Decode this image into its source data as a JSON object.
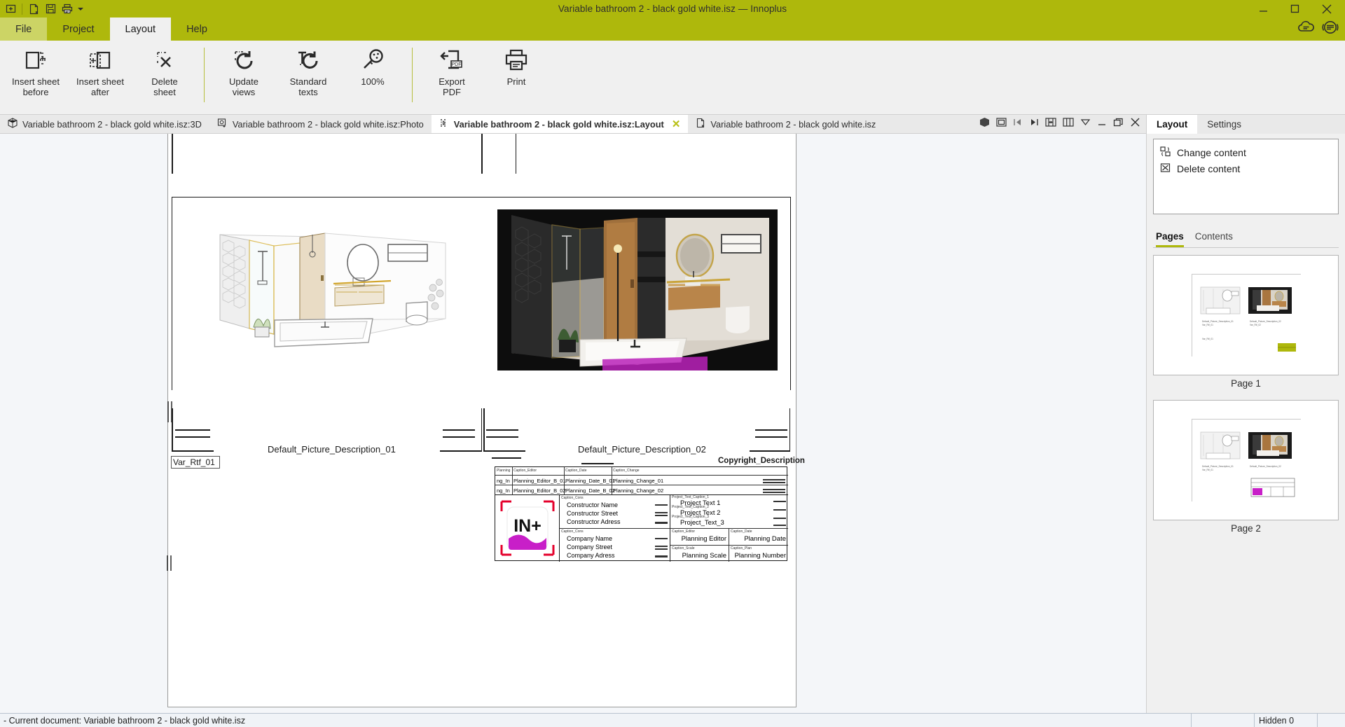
{
  "window": {
    "title": "Variable bathroom 2 - black gold white.isz — Innoplus",
    "accent": "#aeb80c",
    "quick_access": [
      "new-window-icon",
      "new-document-icon",
      "save-icon",
      "print-icon",
      "dropdown-arrow-icon"
    ],
    "controls": [
      "minimize",
      "maximize",
      "close"
    ]
  },
  "menu": {
    "tabs": [
      {
        "label": "File",
        "state": "file"
      },
      {
        "label": "Project",
        "state": "normal"
      },
      {
        "label": "Layout",
        "state": "active"
      },
      {
        "label": "Help",
        "state": "normal"
      }
    ],
    "right_icons": [
      "cloud-chat-icon",
      "support-chat-icon"
    ]
  },
  "ribbon": {
    "groups": [
      {
        "buttons": [
          {
            "label": "Insert sheet\nbefore",
            "icon": "insert-sheet-before-icon"
          },
          {
            "label": "Insert sheet\nafter",
            "icon": "insert-sheet-after-icon"
          },
          {
            "label": "Delete\nsheet",
            "icon": "delete-sheet-icon"
          }
        ]
      },
      {
        "buttons": [
          {
            "label": "Update\nviews",
            "icon": "update-views-icon"
          },
          {
            "label": "Standard\ntexts",
            "icon": "standard-texts-icon"
          },
          {
            "label": "100%",
            "icon": "zoom-100-icon"
          }
        ]
      },
      {
        "buttons": [
          {
            "label": "Export\nPDF",
            "icon": "export-pdf-icon"
          },
          {
            "label": "Print",
            "icon": "print-icon"
          }
        ]
      }
    ]
  },
  "doc_tabs": [
    {
      "label": "Variable bathroom 2 - black gold white.isz:3D",
      "icon": "cube-icon",
      "active": false,
      "closable": false
    },
    {
      "label": "Variable bathroom 2 - black gold white.isz:Photo",
      "icon": "photo-icon",
      "active": false,
      "closable": false
    },
    {
      "label": "Variable bathroom 2 - black gold white.isz:Layout",
      "icon": "layout-icon",
      "active": true,
      "closable": true
    },
    {
      "label": "Variable bathroom 2 - black gold white.isz",
      "icon": "document-icon",
      "active": false,
      "closable": false
    }
  ],
  "tab_window_controls": [
    "cube-icon",
    "restore-view-icon",
    "prev-page-icon",
    "next-page-icon",
    "fit-width-icon",
    "columns-icon",
    "dropdown-icon",
    "minimize-icon",
    "restore-icon",
    "close-icon"
  ],
  "right_panel": {
    "tabs": [
      {
        "label": "Layout",
        "active": true
      },
      {
        "label": "Settings",
        "active": false
      }
    ],
    "actions": [
      {
        "label": "Change content",
        "icon": "change-content-icon"
      },
      {
        "label": "Delete content",
        "icon": "delete-content-icon"
      }
    ],
    "subtabs": [
      {
        "label": "Pages",
        "active": true
      },
      {
        "label": "Contents",
        "active": false
      }
    ],
    "pages": [
      {
        "label": "Page 1"
      },
      {
        "label": "Page 2"
      }
    ]
  },
  "document": {
    "picture_caption_left": "Default_Picture_Description_01",
    "picture_caption_right": "Default_Picture_Description_02",
    "var_rtf": "Var_Rtf_01",
    "copyright": "Copyright_Description",
    "title_block": {
      "header_row": [
        "Planning",
        "Caption_Editor",
        "Caption_Date",
        "Caption_Change"
      ],
      "rows": [
        {
          "c0": "ng_In",
          "c1": "Planning_Editor_B_01",
          "c2": "Planning_Date_B_01",
          "c3": "Planning_Change_01"
        },
        {
          "c0": "ng_In",
          "c1": "Planning_Editor_B_02",
          "c2": "Planning_Date_B_02",
          "c3": "Planning_Change_02"
        }
      ],
      "logo_text": "IN+",
      "constructor_caption": "Caption_Cons",
      "constructor": [
        "Constructor Name",
        "Constructor Street",
        "Constructor Adress"
      ],
      "company_caption": "Caption_Cons",
      "company": [
        "Company Name",
        "Company Street",
        "Company Adress"
      ],
      "project_captions": [
        "Project_Text_Caption_1",
        "Project_Text_Caption_2",
        "Project_Text_Caption_3"
      ],
      "project": [
        "Project Text 1",
        "Project Text 2",
        "Project_Text_3"
      ],
      "editor_caption": "Caption_Editor",
      "editor_value": "Planning Editor",
      "date_caption": "Caption_Date",
      "date_value": "Planning Date",
      "scale_caption": "Caption_Scale",
      "scale_value": "Planning Scale",
      "number_caption": "Caption_Plan",
      "number_value": "Planning Number"
    }
  },
  "status_bar": {
    "message": "- Current document: Variable bathroom 2 - black gold white.isz",
    "cells": [
      "",
      "Hidden 0",
      ""
    ]
  }
}
